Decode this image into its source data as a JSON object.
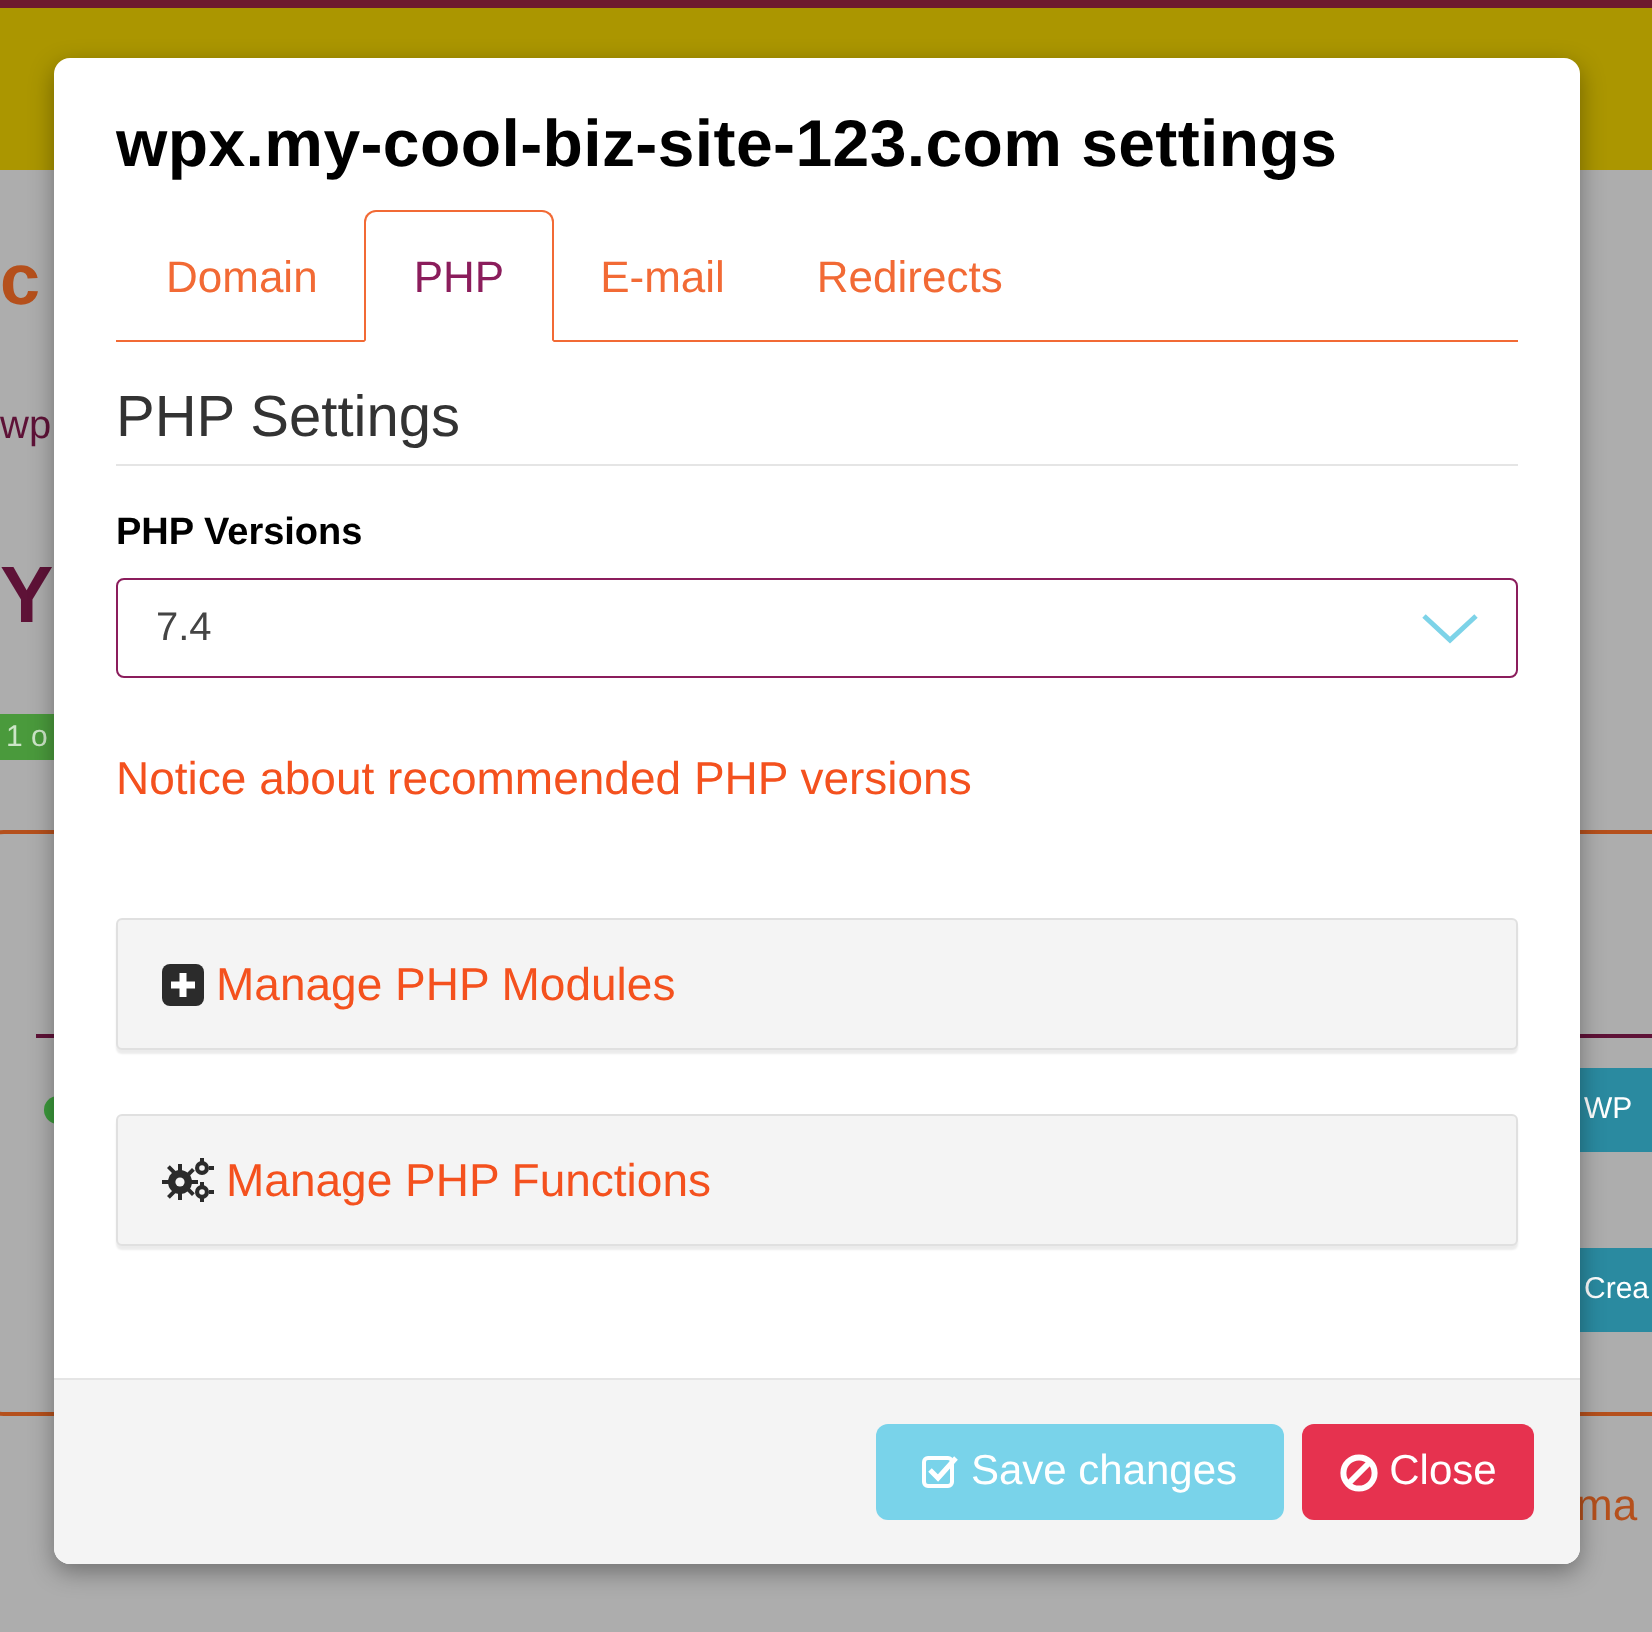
{
  "background": {
    "heading_fragment": "c",
    "link_fragment": "wp",
    "title_fragment": "Y",
    "badge_fragment": "1 o",
    "buttons": [
      "WP",
      "Crea"
    ],
    "footer_fragment": "ma"
  },
  "modal": {
    "title": "wpx.my-cool-biz-site-123.com settings",
    "tabs": [
      {
        "label": "Domain",
        "selected": false
      },
      {
        "label": "PHP",
        "selected": true
      },
      {
        "label": "E-mail",
        "selected": false
      },
      {
        "label": "Redirects",
        "selected": false
      }
    ],
    "section_title": "PHP Settings",
    "php_versions": {
      "label": "PHP Versions",
      "value": "7.4"
    },
    "notice": "Notice about recommended PHP versions",
    "panels": [
      {
        "kind": "modules",
        "label": "Manage PHP Modules"
      },
      {
        "kind": "functions",
        "label": "Manage PHP Functions"
      }
    ],
    "buttons": [
      {
        "kind": "save",
        "label": "Save changes"
      },
      {
        "kind": "close",
        "label": "Close"
      }
    ]
  }
}
